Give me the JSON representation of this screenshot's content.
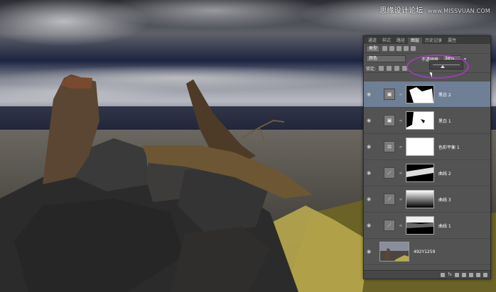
{
  "watermark": {
    "brand": "思缘设计论坛",
    "url": "www.MISSVUAN.COM"
  },
  "panel": {
    "tabs": [
      "通道",
      "样式",
      "路径",
      "图层",
      "历史记录",
      "属性"
    ],
    "active_tab_index": 3,
    "filter_label": "类型",
    "blend_mode": "颜色",
    "opacity_label": "不透明度:",
    "opacity_value": "38%",
    "lock_label": "锁定:",
    "opacity_slider_level": 0.38,
    "layers": [
      {
        "name": "黑白 2",
        "icon": "adjustment-icon",
        "active": true,
        "mask": "bw2"
      },
      {
        "name": "黑白 1",
        "icon": "adjustment-icon",
        "active": false,
        "mask": "bw1"
      },
      {
        "name": "色彩平衡 1",
        "icon": "balance-icon",
        "active": false,
        "mask": "white"
      },
      {
        "name": "曲线 2",
        "icon": "curves-icon",
        "active": false,
        "mask": "curves2"
      },
      {
        "name": "曲线 3",
        "icon": "curves-icon",
        "active": false,
        "mask": "gradient"
      },
      {
        "name": "曲线 1",
        "icon": "curves-icon",
        "active": false,
        "mask": "curves1"
      },
      {
        "name": "492Y1259",
        "icon": "image-icon",
        "active": false,
        "mask": "photo"
      }
    ],
    "bottom_icons": [
      "link-icon",
      "fx-icon",
      "mask-icon",
      "adjustment-icon",
      "folder-icon",
      "new-layer-icon",
      "trash-icon"
    ],
    "fx_label": "fx"
  },
  "colors": {
    "panel_bg": "#535353",
    "active_layer": "#6f7f95",
    "highlight_ring": "#9b3fb0"
  }
}
